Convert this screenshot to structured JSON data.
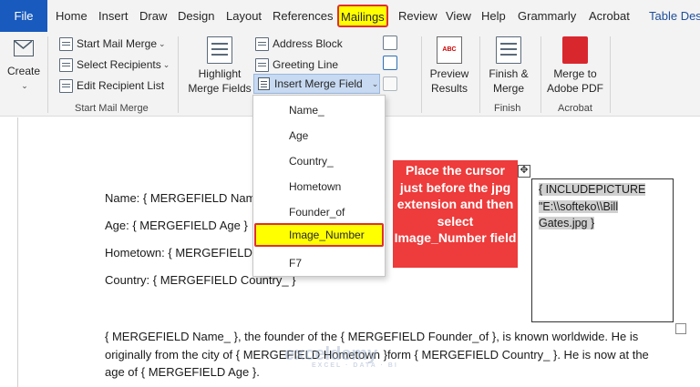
{
  "menu": {
    "file": "File",
    "tabs": [
      "Home",
      "Insert",
      "Draw",
      "Design",
      "Layout",
      "References",
      "Mailings",
      "Review",
      "View",
      "Help",
      "Grammarly",
      "Acrobat",
      "Table Des"
    ]
  },
  "ribbon": {
    "create": {
      "label": "Create",
      "group": ""
    },
    "start_mail_merge": {
      "group": "Start Mail Merge",
      "buttons": [
        "Start Mail Merge",
        "Select Recipients",
        "Edit Recipient List"
      ]
    },
    "write_insert": {
      "highlight_line1": "Highlight",
      "highlight_line2": "Merge Fields",
      "address_block": "Address Block",
      "greeting_line": "Greeting Line",
      "insert_merge_field": "Insert Merge Field"
    },
    "preview": {
      "line1": "Preview",
      "line2": "Results"
    },
    "finish": {
      "line1": "Finish &",
      "line2": "Merge",
      "group": "Finish"
    },
    "acrobat": {
      "line1": "Merge to",
      "line2": "Adobe PDF",
      "group": "Acrobat"
    },
    "preview_icon_text": "ABC"
  },
  "dropdown": {
    "items": [
      "Name_",
      "Age",
      "Country_",
      "Hometown",
      "Founder_of",
      "Image_Number",
      "F7"
    ],
    "selected": "Image_Number"
  },
  "document": {
    "lines": [
      "Name: { MERGEFIELD Name",
      "Age: { MERGEFIELD Age }",
      "Hometown: { MERGEFIELD",
      "Country: { MERGEFIELD Country_ }"
    ],
    "paragraph": "{ MERGEFIELD Name_ }, the founder of the { MERGEFIELD Founder_of }, is known worldwide. He is originally from the city of { MERGEFIELD Hometown }form { MERGEFIELD Country_ }. He is now at the age of { MERGEFIELD Age }.",
    "frame_field": "{ INCLUDEPICTURE \"E:\\\\softeko\\\\Bill Gates.jpg }"
  },
  "callout": "Place the cursor just before the jpg extension and then select Image_Number field",
  "watermark": {
    "name": "exceldemy",
    "tagline": "EXCEL · DATA · BI"
  },
  "colors": {
    "file_tab": "#185abd",
    "highlight": "#ffff00",
    "callout": "#ee3b3b",
    "outline": "#e03030"
  }
}
